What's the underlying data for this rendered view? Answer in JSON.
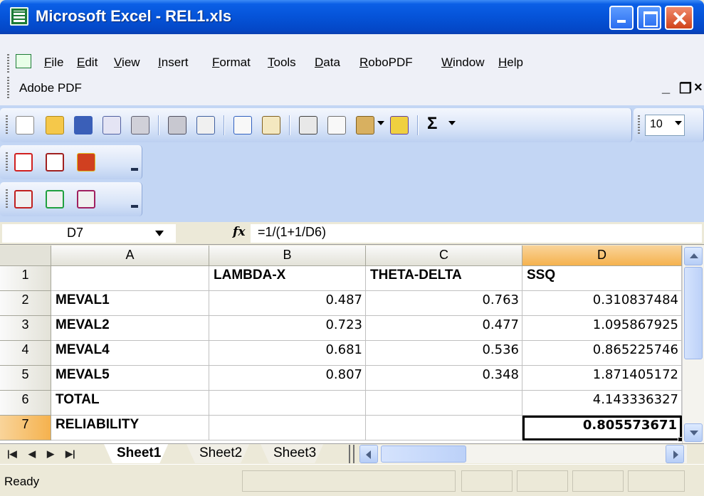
{
  "window": {
    "title": "Microsoft Excel - REL1.xls"
  },
  "menu": {
    "items": [
      "File",
      "Edit",
      "View",
      "Insert",
      "Format",
      "Tools",
      "Data",
      "RoboPDF",
      "Window",
      "Help"
    ],
    "adobe": "Adobe PDF",
    "doc_controls": [
      "_",
      "Ɖ",
      "×"
    ]
  },
  "toolbar": {
    "font_size": "10",
    "sigma": "Σ"
  },
  "formula_bar": {
    "name_box": "D7",
    "fx": "fx",
    "formula": "=1/(1+1/D6)"
  },
  "grid": {
    "columns": [
      "A",
      "B",
      "C",
      "D"
    ],
    "rows": [
      {
        "num": "1",
        "a": "",
        "b": "LAMBDA-X",
        "c": "THETA-DELTA",
        "d": "SSQ"
      },
      {
        "num": "2",
        "a": "MEVAL1",
        "b": "0.487",
        "c": "0.763",
        "d": "0.310837484"
      },
      {
        "num": "3",
        "a": "MEVAL2",
        "b": "0.723",
        "c": "0.477",
        "d": "1.095867925"
      },
      {
        "num": "4",
        "a": "MEVAL4",
        "b": "0.681",
        "c": "0.536",
        "d": "0.865225746"
      },
      {
        "num": "5",
        "a": "MEVAL5",
        "b": "0.807",
        "c": "0.348",
        "d": "1.871405172"
      },
      {
        "num": "6",
        "a": "TOTAL",
        "b": "",
        "c": "",
        "d": "4.143336327"
      },
      {
        "num": "7",
        "a": "RELIABILITY",
        "b": "",
        "c": "",
        "d": "0.805573671"
      }
    ],
    "active_cell": "D7"
  },
  "sheets": [
    "Sheet1",
    "Sheet2",
    "Sheet3"
  ],
  "status": {
    "text": "Ready"
  },
  "colors": {
    "title_blue": "#0553d8",
    "active_header": "#f5b24e",
    "toolbar_blue": "#c3d6f4"
  }
}
